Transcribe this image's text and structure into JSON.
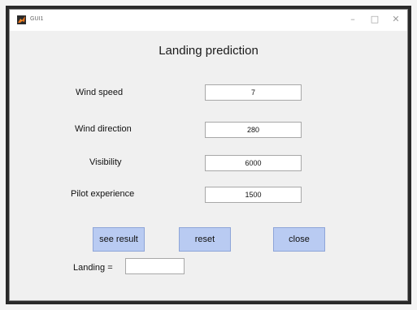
{
  "window": {
    "title": "GUI1",
    "app_icon": "matlab-icon",
    "controls": {
      "minimize": "–",
      "maximize": "□",
      "close": "✕"
    }
  },
  "form": {
    "heading": "Landing prediction",
    "fields": {
      "wind_speed": {
        "label": "Wind speed",
        "value": "7"
      },
      "wind_direction": {
        "label": "Wind direction",
        "value": "280"
      },
      "visibility": {
        "label": "Visibility",
        "value": "6000"
      },
      "pilot_experience": {
        "label": "Pilot experience",
        "value": "1500"
      }
    },
    "buttons": {
      "see_result": "see result",
      "reset": "reset",
      "close": "close"
    },
    "result": {
      "label": "Landing =",
      "value": ""
    }
  },
  "colors": {
    "button_fill": "#b9cbf2",
    "window_bg": "#f0f0f0"
  }
}
